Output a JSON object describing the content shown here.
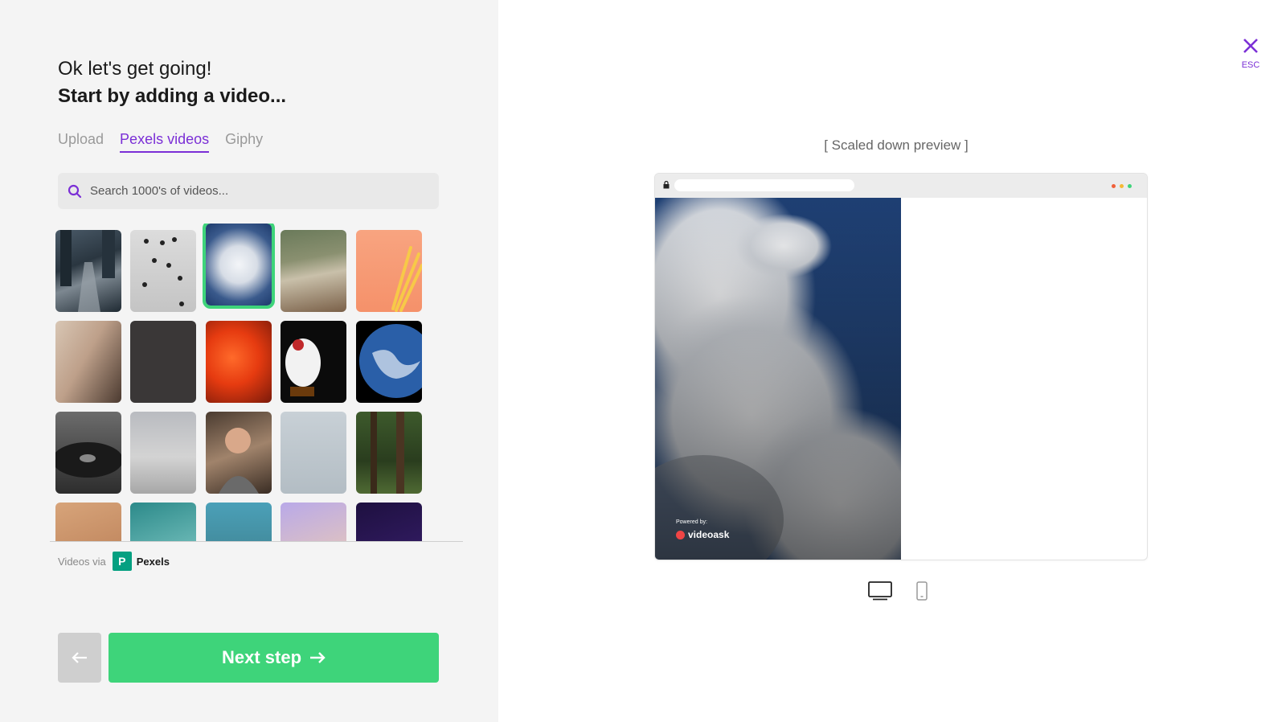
{
  "heading": {
    "line1": "Ok let's get going!",
    "line2": "Start by adding a video..."
  },
  "tabs": [
    {
      "label": "Upload",
      "active": false
    },
    {
      "label": "Pexels videos",
      "active": true
    },
    {
      "label": "Giphy",
      "active": false
    }
  ],
  "search": {
    "placeholder": "Search 1000's of videos...",
    "icon": "search-icon"
  },
  "thumbnails": [
    {
      "subject": "city street aerial",
      "selected": false
    },
    {
      "subject": "people walking",
      "selected": false
    },
    {
      "subject": "clouds sky",
      "selected": true
    },
    {
      "subject": "beach waves aerial",
      "selected": false
    },
    {
      "subject": "french fries",
      "selected": false
    },
    {
      "subject": "hand with phone",
      "selected": false
    },
    {
      "subject": "dark surface",
      "selected": false
    },
    {
      "subject": "orange abstract",
      "selected": false
    },
    {
      "subject": "lucky cat figurine",
      "selected": false
    },
    {
      "subject": "earth from space",
      "selected": false
    },
    {
      "subject": "record player",
      "selected": false
    },
    {
      "subject": "reflection street",
      "selected": false
    },
    {
      "subject": "woman with phone",
      "selected": false
    },
    {
      "subject": "snowy ground aerial",
      "selected": false
    },
    {
      "subject": "forest",
      "selected": false
    },
    {
      "subject": "skin closeup",
      "selected": false
    },
    {
      "subject": "ocean waves",
      "selected": false
    },
    {
      "subject": "beach",
      "selected": false
    },
    {
      "subject": "purple hair",
      "selected": false
    },
    {
      "subject": "night sky",
      "selected": false
    }
  ],
  "attribution": {
    "prefix": "Videos via",
    "logo_letter": "P",
    "brand": "Pexels"
  },
  "buttons": {
    "back_icon": "arrow-left-icon",
    "next_label": "Next step",
    "next_icon": "arrow-right-icon"
  },
  "close": {
    "label": "ESC",
    "icon": "close-icon"
  },
  "preview": {
    "label": "[ Scaled down preview ]",
    "powered_by": "Powered by:",
    "brand": "videoask",
    "window_dots": [
      "#f0603a",
      "#f5b935",
      "#3ed47a"
    ]
  },
  "device_toggle": [
    {
      "icon": "desktop-icon",
      "active": true
    },
    {
      "icon": "mobile-icon",
      "active": false
    }
  ],
  "colors": {
    "accent": "#7b2fd6",
    "primary": "#3ed47a",
    "panel_bg": "#f4f4f4"
  }
}
